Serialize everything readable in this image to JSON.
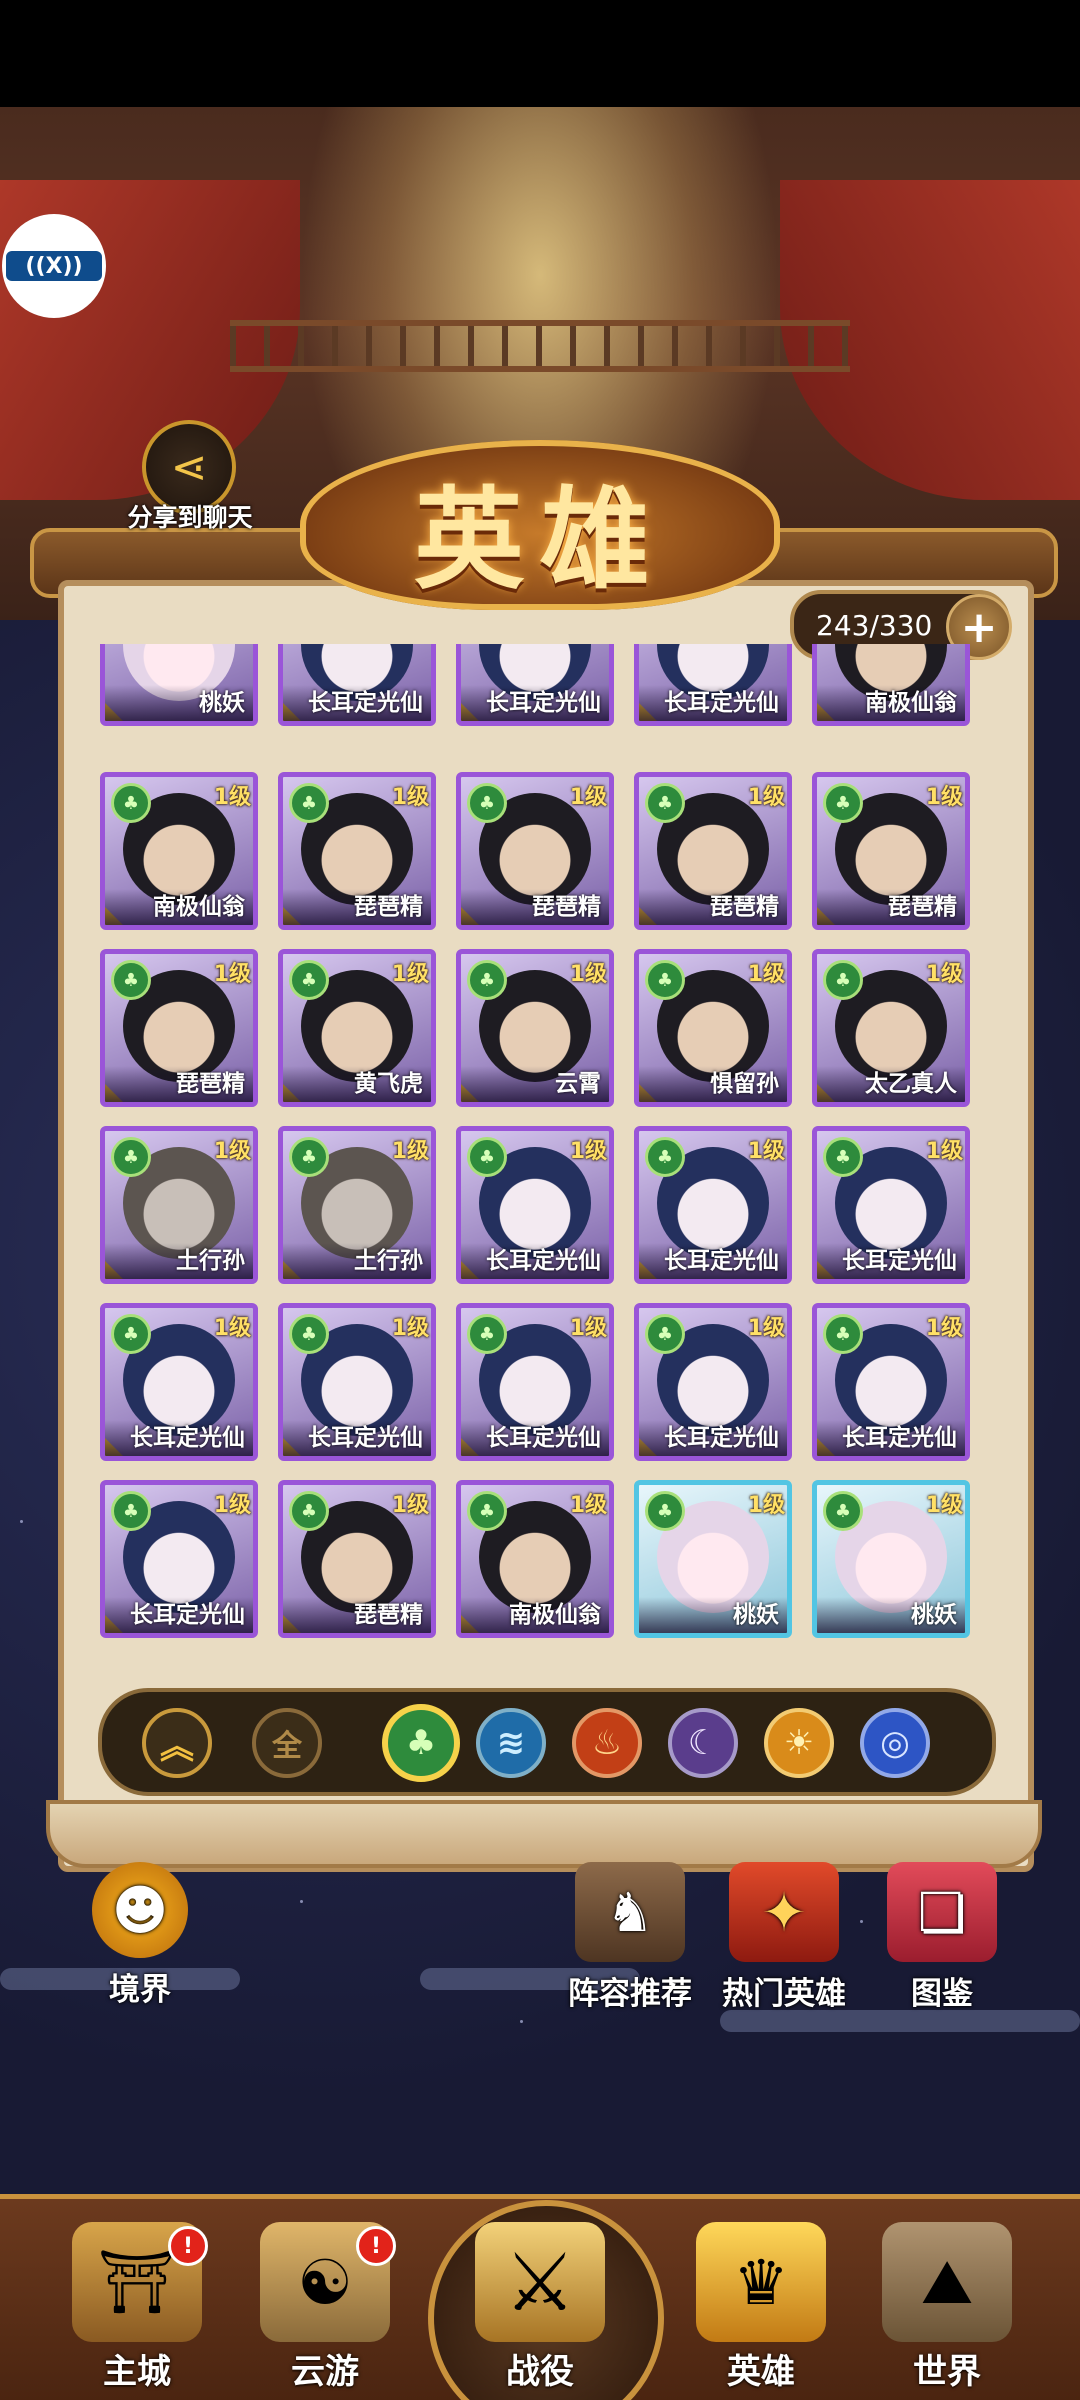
{
  "header": {
    "title": "英雄",
    "share_label": "分享到聊天",
    "record_label": "((X))"
  },
  "counter": {
    "value": "243/330",
    "plus": "+"
  },
  "heroes": [
    {
      "name": "桃妖",
      "level": "",
      "variant": "pale",
      "border": "purple"
    },
    {
      "name": "长耳定光仙",
      "level": "",
      "variant": "blue",
      "border": "purple"
    },
    {
      "name": "长耳定光仙",
      "level": "",
      "variant": "blue",
      "border": "purple"
    },
    {
      "name": "长耳定光仙",
      "level": "",
      "variant": "blue",
      "border": "purple"
    },
    {
      "name": "南极仙翁",
      "level": "",
      "variant": "dark",
      "border": "purple"
    },
    {
      "name": "南极仙翁",
      "level": "1级",
      "variant": "dark",
      "border": "purple"
    },
    {
      "name": "琵琶精",
      "level": "1级",
      "variant": "dark",
      "border": "purple"
    },
    {
      "name": "琵琶精",
      "level": "1级",
      "variant": "dark",
      "border": "purple"
    },
    {
      "name": "琵琶精",
      "level": "1级",
      "variant": "dark",
      "border": "purple"
    },
    {
      "name": "琵琶精",
      "level": "1级",
      "variant": "dark",
      "border": "purple"
    },
    {
      "name": "琵琶精",
      "level": "1级",
      "variant": "dark",
      "border": "purple"
    },
    {
      "name": "黄飞虎",
      "level": "1级",
      "variant": "dark",
      "border": "purple"
    },
    {
      "name": "云霄",
      "level": "1级",
      "variant": "dark",
      "border": "purple"
    },
    {
      "name": "惧留孙",
      "level": "1级",
      "variant": "dark",
      "border": "purple"
    },
    {
      "name": "太乙真人",
      "level": "1级",
      "variant": "dark",
      "border": "purple"
    },
    {
      "name": "土行孙",
      "level": "1级",
      "variant": "grey",
      "border": "purple"
    },
    {
      "name": "土行孙",
      "level": "1级",
      "variant": "grey",
      "border": "purple"
    },
    {
      "name": "长耳定光仙",
      "level": "1级",
      "variant": "blue",
      "border": "purple"
    },
    {
      "name": "长耳定光仙",
      "level": "1级",
      "variant": "blue",
      "border": "purple"
    },
    {
      "name": "长耳定光仙",
      "level": "1级",
      "variant": "blue",
      "border": "purple"
    },
    {
      "name": "长耳定光仙",
      "level": "1级",
      "variant": "blue",
      "border": "purple"
    },
    {
      "name": "长耳定光仙",
      "level": "1级",
      "variant": "blue",
      "border": "purple"
    },
    {
      "name": "长耳定光仙",
      "level": "1级",
      "variant": "blue",
      "border": "purple"
    },
    {
      "name": "长耳定光仙",
      "level": "1级",
      "variant": "blue",
      "border": "purple"
    },
    {
      "name": "长耳定光仙",
      "level": "1级",
      "variant": "blue",
      "border": "purple"
    },
    {
      "name": "长耳定光仙",
      "level": "1级",
      "variant": "blue",
      "border": "purple"
    },
    {
      "name": "琵琶精",
      "level": "1级",
      "variant": "dark",
      "border": "purple"
    },
    {
      "name": "南极仙翁",
      "level": "1级",
      "variant": "dark",
      "border": "purple"
    },
    {
      "name": "桃妖",
      "level": "1级",
      "variant": "pale",
      "border": "cyan"
    },
    {
      "name": "桃妖",
      "level": "1级",
      "variant": "pale",
      "border": "cyan"
    }
  ],
  "filters": {
    "sort_icon": "chevron-up-double-icon",
    "all_label": "全",
    "elements": [
      "wood-icon",
      "water-icon",
      "fire-icon",
      "moon-icon",
      "sun-icon",
      "vortex-icon"
    ]
  },
  "actions": {
    "realm": "境界",
    "lineup": "阵容推荐",
    "popular": "热门英雄",
    "codex": "图鉴"
  },
  "nav": {
    "main_city": "主城",
    "travel": "云游",
    "battle": "战役",
    "heroes": "英雄",
    "world": "世界",
    "badge": "!"
  },
  "colors": {
    "purple_border": "#9a55d8",
    "cyan_border": "#52c5e3",
    "level_text": "#ffe066",
    "wood_element": "#2e8b3c",
    "nav_bg": "#6c3a1e"
  }
}
